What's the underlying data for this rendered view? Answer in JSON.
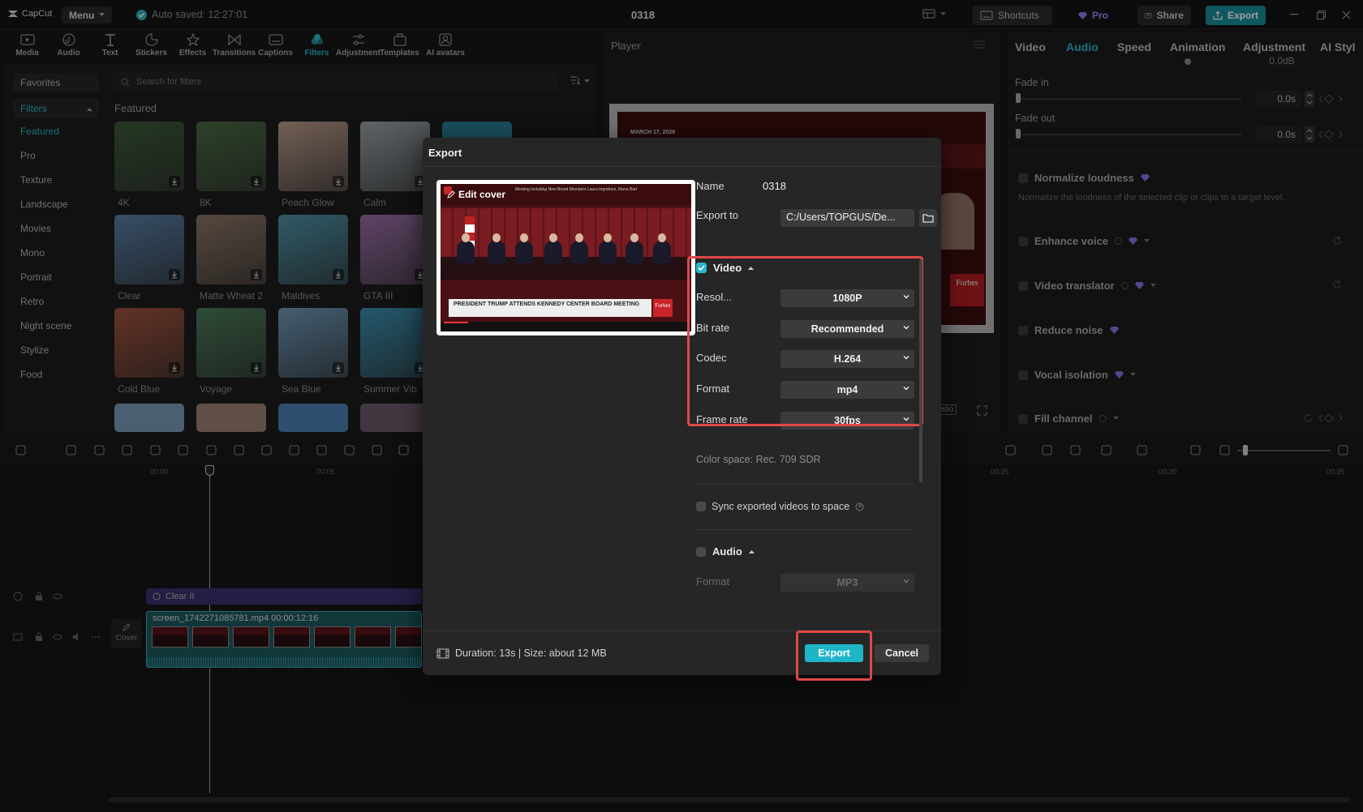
{
  "titlebar": {
    "app_name": "CapCut",
    "menu_label": "Menu",
    "autosave": "Auto saved: 12:27:01",
    "project": "0318",
    "shortcuts": "Shortcuts",
    "pro": "Pro",
    "share": "Share",
    "export": "Export"
  },
  "tooltabs": [
    {
      "label": "Media",
      "icon": "media-icon"
    },
    {
      "label": "Audio",
      "icon": "audio-icon"
    },
    {
      "label": "Text",
      "icon": "text-icon"
    },
    {
      "label": "Stickers",
      "icon": "stickers-icon"
    },
    {
      "label": "Effects",
      "icon": "effects-icon"
    },
    {
      "label": "Transitions",
      "icon": "transitions-icon"
    },
    {
      "label": "Captions",
      "icon": "captions-icon"
    },
    {
      "label": "Filters",
      "icon": "filters-icon",
      "active": true
    },
    {
      "label": "Adjustment",
      "icon": "adjustment-icon"
    },
    {
      "label": "Templates",
      "icon": "templates-icon"
    },
    {
      "label": "AI avatars",
      "icon": "ai-avatars-icon"
    }
  ],
  "filters": {
    "favorites": "Favorites",
    "filters_label": "Filters",
    "search_placeholder": "Search for filters",
    "section_title": "Featured",
    "categories": [
      "Featured",
      "Pro",
      "Texture",
      "Landscape",
      "Movies",
      "Mono",
      "Portrait",
      "Retro",
      "Night scene",
      "Stylize",
      "Food"
    ],
    "thumbs": [
      {
        "label": "4K",
        "color": "#3d5a3a"
      },
      {
        "label": "8K",
        "color": "#4a6a44"
      },
      {
        "label": "Peach Glow",
        "color": "#b89a8a"
      },
      {
        "label": "Calm",
        "color": "#9aa2a8"
      },
      {
        "label": "Clear",
        "color": "#5a7fa6"
      },
      {
        "label": "Matte Wheat 2",
        "color": "#8b7566"
      },
      {
        "label": "Maldives",
        "color": "#4f92a6"
      },
      {
        "label": "GTA III",
        "color": "#9a6fa6"
      },
      {
        "label": "Cold Blue",
        "color": "#a0523c"
      },
      {
        "label": "Voyage",
        "color": "#4b7a5a"
      },
      {
        "label": "Sea Blue",
        "color": "#6f98b8"
      },
      {
        "label": "Summer Vib",
        "color": "#3b8fb0"
      }
    ]
  },
  "player": {
    "title": "Player",
    "ratio": "Ratio",
    "date_text": "MARCH 17, 2026",
    "brand": "Forbes"
  },
  "rightpanel": {
    "tabs": [
      "Video",
      "Audio",
      "Speed",
      "Animation",
      "Adjustment",
      "AI Styl"
    ],
    "fade_in": "Fade in",
    "fade_out": "Fade out",
    "fade_in_val": "0.0s",
    "fade_out_val": "0.0s",
    "top_val": "0.0dB",
    "normalize": "Normalize loudness",
    "normalize_desc": "Normalize the loudness of the selected clip or clips to a target level.",
    "enhance": "Enhance voice",
    "translator": "Video translator",
    "reduce": "Reduce noise",
    "vocal": "Vocal isolation",
    "fill": "Fill channel"
  },
  "timeline": {
    "t0": "00:00",
    "t5": "00:05",
    "t25": "00:25",
    "t30": "00:30",
    "t35": "00:35",
    "filter_clip": "Clear II",
    "video_clip": "screen_1742271085781.mp4  00:00:12:16",
    "cover": "Cover"
  },
  "dialog": {
    "title": "Export",
    "edit_cover": "Edit cover",
    "name_label": "Name",
    "name_value": "0318",
    "export_to_label": "Export to",
    "export_to_value": "C:/Users/TOPGUS/De...",
    "video_section": "Video",
    "resolution_label": "Resol...",
    "resolution_value": "1080P",
    "bitrate_label": "Bit rate",
    "bitrate_value": "Recommended",
    "codec_label": "Codec",
    "codec_value": "H.264",
    "format_label": "Format",
    "format_value": "mp4",
    "framerate_label": "Frame rate",
    "framerate_value": "30fps",
    "color_space": "Color space: Rec. 709 SDR",
    "sync_label": "Sync exported videos to space",
    "audio_section": "Audio",
    "audio_format_label": "Format",
    "audio_format_value": "MP3",
    "footer_info": "Duration: 13s | Size: about 12 MB",
    "export_button": "Export",
    "cancel_button": "Cancel",
    "video_headline": "Meeting Including New Board Members Laura Ingraham, Maria Bartiromo",
    "video_caption": "PRESIDENT TRUMP ATTENDS KENNEDY CENTER BOARD MEETING",
    "video_brand": "Forbes"
  },
  "colors": {
    "accent": "#27b8c9",
    "highlight": "#e04848",
    "export_btn": "#1fb5c8"
  }
}
